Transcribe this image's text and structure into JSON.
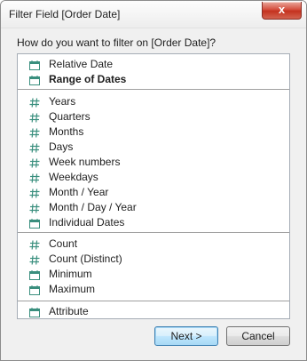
{
  "window": {
    "title": "Filter Field [Order Date]",
    "close_symbol": "x"
  },
  "prompt": "How do you want to filter on [Order Date]?",
  "groups": [
    [
      {
        "label": "Relative Date",
        "icon": "calendar-icon"
      },
      {
        "label": "Range of Dates",
        "icon": "calendar-icon",
        "bold": true
      }
    ],
    [
      {
        "label": "Years",
        "icon": "hash-icon"
      },
      {
        "label": "Quarters",
        "icon": "hash-icon"
      },
      {
        "label": "Months",
        "icon": "hash-icon"
      },
      {
        "label": "Days",
        "icon": "hash-icon"
      },
      {
        "label": "Week numbers",
        "icon": "hash-icon"
      },
      {
        "label": "Weekdays",
        "icon": "hash-icon"
      },
      {
        "label": "Month / Year",
        "icon": "hash-icon"
      },
      {
        "label": "Month / Day / Year",
        "icon": "hash-icon"
      },
      {
        "label": "Individual Dates",
        "icon": "calendar-icon"
      }
    ],
    [
      {
        "label": "Count",
        "icon": "hash-icon"
      },
      {
        "label": "Count (Distinct)",
        "icon": "hash-icon"
      },
      {
        "label": "Minimum",
        "icon": "calendar-icon"
      },
      {
        "label": "Maximum",
        "icon": "calendar-icon"
      }
    ],
    [
      {
        "label": "Attribute",
        "icon": "calendar-icon"
      }
    ]
  ],
  "buttons": {
    "next": "Next >",
    "cancel": "Cancel"
  },
  "colors": {
    "icon": "#3a8f7e",
    "close_button": "#c7402d"
  }
}
